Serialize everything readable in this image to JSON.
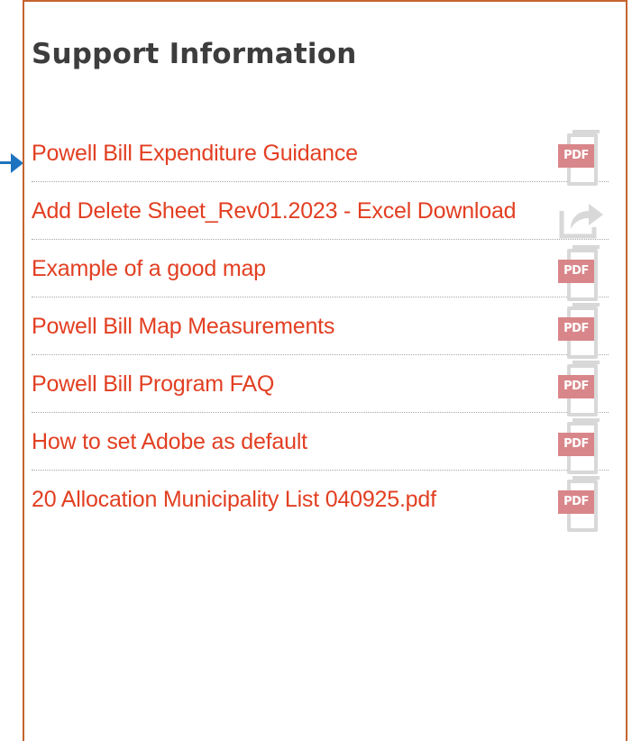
{
  "widget": {
    "title": "Support Information"
  },
  "links": [
    {
      "label": "Powell Bill Expenditure Guidance",
      "icon": "pdf-icon",
      "icon_text": "PDF"
    },
    {
      "label": "Add Delete Sheet_Rev01.2023 - Excel Download",
      "icon": "external-link-icon",
      "icon_text": ""
    },
    {
      "label": "Example of a good map",
      "icon": "pdf-icon",
      "icon_text": "PDF"
    },
    {
      "label": "Powell Bill Map Measurements",
      "icon": "pdf-icon",
      "icon_text": "PDF"
    },
    {
      "label": "Powell Bill Program FAQ",
      "icon": "pdf-icon",
      "icon_text": "PDF"
    },
    {
      "label": "How to set Adobe as default",
      "icon": "pdf-icon",
      "icon_text": "PDF"
    },
    {
      "label": "20 Allocation Municipality List 040925.pdf",
      "icon": "pdf-icon",
      "icon_text": "PDF"
    }
  ],
  "colors": {
    "link": "#e23f22",
    "title": "#3d3d3d",
    "panel_border": "#c5642f",
    "pointer_arrow": "#1e73be",
    "pdf_tag": "#d9868a",
    "icon_gray": "#d8d8d8"
  }
}
